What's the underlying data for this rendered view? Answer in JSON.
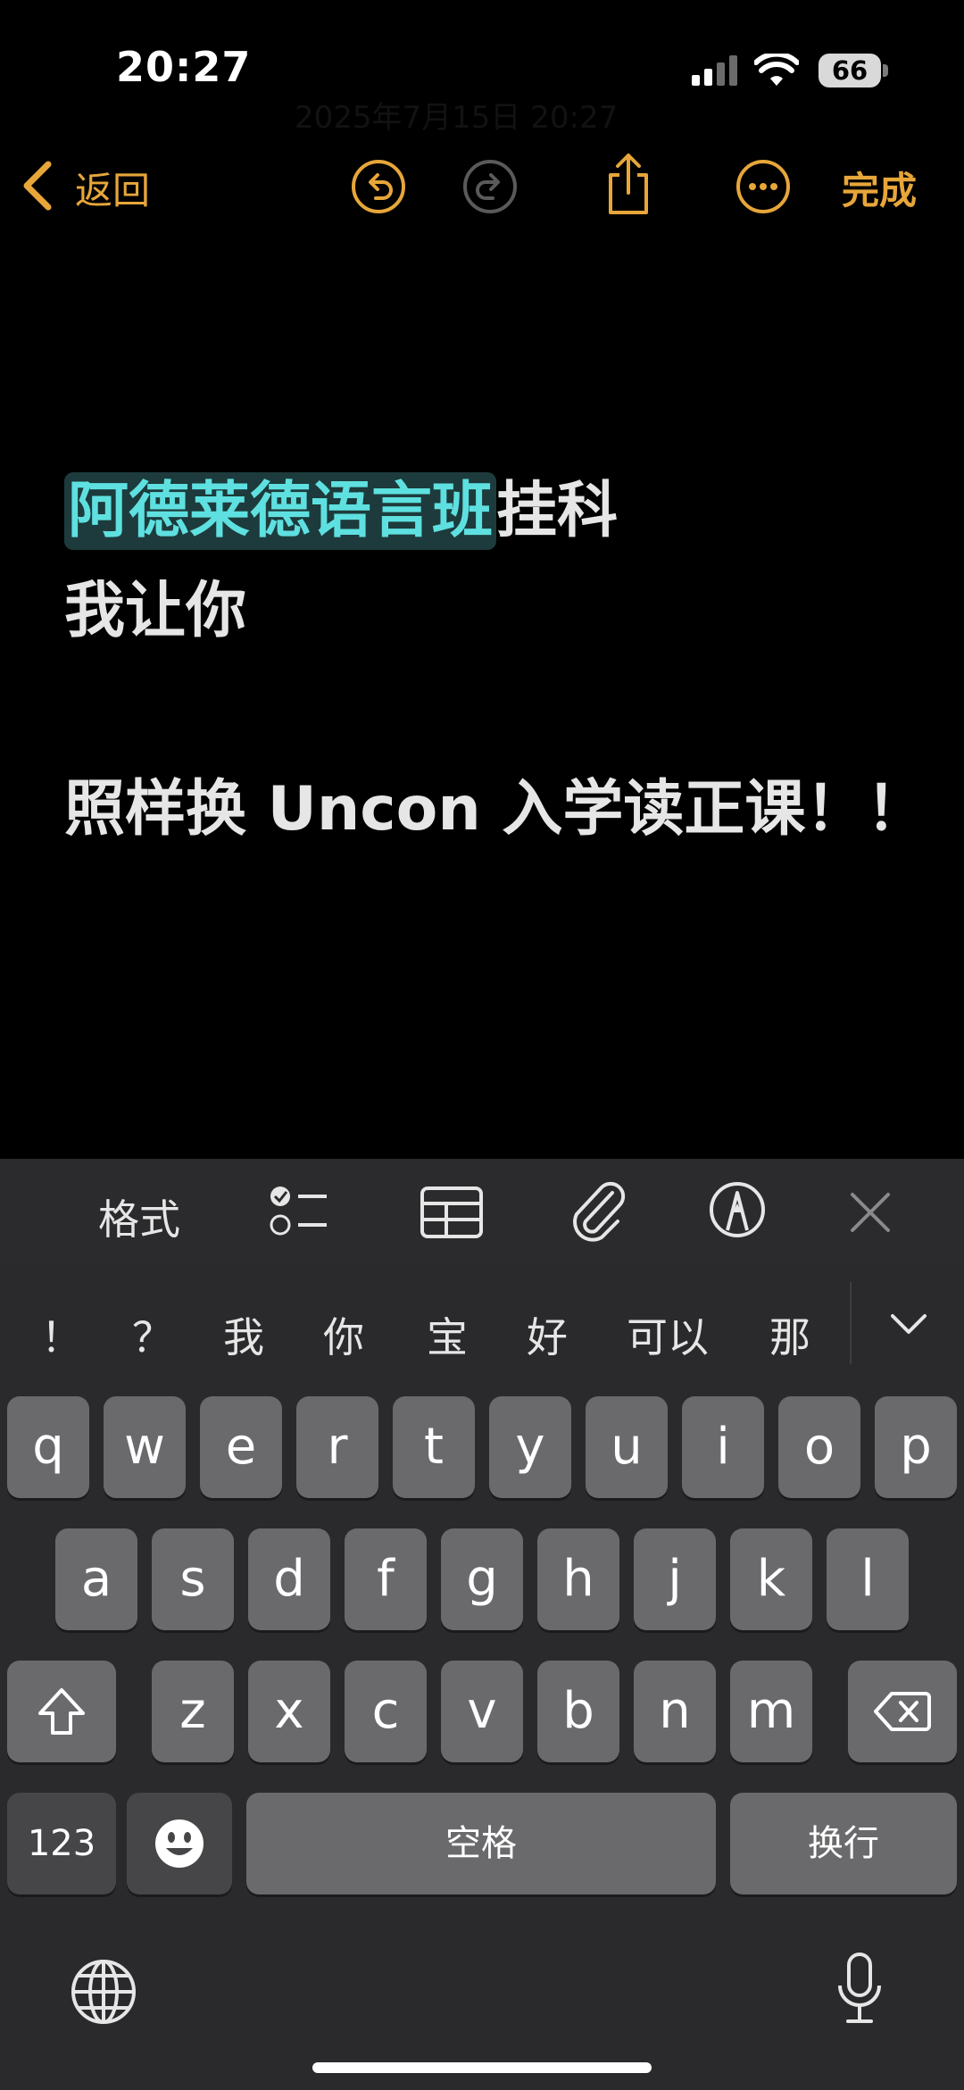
{
  "status_bar": {
    "time": "20:27",
    "battery": "66"
  },
  "note_date_faint": "2025年7月15日 20:27",
  "nav": {
    "back_label": "返回",
    "done_label": "完成"
  },
  "note": {
    "line1_selected": "阿德莱德语言班",
    "line1_rest": "挂科",
    "line2": "我让你",
    "line3": "照样换 Uncon 入学读正课！！"
  },
  "format_toolbar": {
    "format_label": "格式"
  },
  "candidates": [
    "！",
    "？",
    "我",
    "你",
    "宝",
    "好",
    "可以",
    "那"
  ],
  "keyboard": {
    "row1": [
      "q",
      "w",
      "e",
      "r",
      "t",
      "y",
      "u",
      "i",
      "o",
      "p"
    ],
    "row2": [
      "a",
      "s",
      "d",
      "f",
      "g",
      "h",
      "j",
      "k",
      "l"
    ],
    "row3": [
      "z",
      "x",
      "c",
      "v",
      "b",
      "n",
      "m"
    ],
    "numbers_label": "123",
    "space_label": "空格",
    "return_label": "换行"
  },
  "colors": {
    "accent": "#e7a63a",
    "selection_text": "#5fe0e0",
    "selection_bg": "#1d3b3c"
  }
}
